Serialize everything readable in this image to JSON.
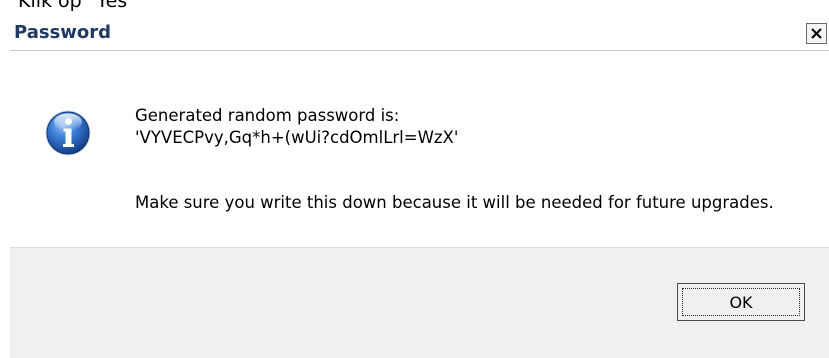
{
  "background_caption": "Klik op \"Yes\"",
  "dialog": {
    "title": "Password",
    "close_icon": "close-x-icon",
    "message_icon": "information-icon",
    "message_line1": "Generated random password is:",
    "message_line2": "'VYVECPvy,Gq*h+(wUi?cdOmlLrl=WzX'",
    "note": "Make sure you write this down because it will be needed for future upgrades.",
    "ok_label": "OK"
  },
  "colors": {
    "title_text": "#1f3a62",
    "footer_background": "#f0f0f0",
    "icon_blue": "#1c5fb8"
  }
}
